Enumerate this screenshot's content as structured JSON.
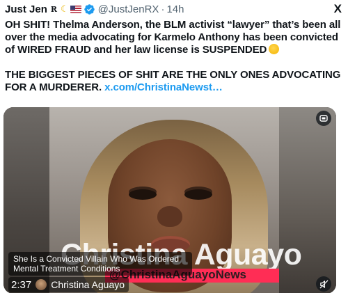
{
  "tweet": {
    "author_name": "Just Jen",
    "author_tag": "R",
    "handle": "@JustJenRX",
    "time_separator": "·",
    "time_ago": "14h",
    "line1": "OH SHIT! Thelma Anderson, the BLM activist “lawyer” that’s been all over the media advocating for Karmelo Anthony has been convicted of WIRED FRAUD and her law license is SUSPENDED",
    "line2": "THE BIGGEST PIECES OF SHIT ARE THE ONLY ONES ADVOCATING FOR A MURDERER.",
    "link_text": "x.com/ChristinaNewst…",
    "close_glyph": "X"
  },
  "video": {
    "overlay_name": "Christina Aguayo",
    "overlay_handle": "@ChristinaAguayoNews",
    "caption": "She Is a Convicted Villain Who Was Ordered Mental Treatment Conditions",
    "duration": "2:37",
    "channel": "Christina Aguayo"
  },
  "icons": {
    "verified": "verified-badge-icon",
    "emoji": "moon-and-us-flag-emoji",
    "grin": "grinning-face-emoji",
    "gif": "gif-icon",
    "mute": "muted-speaker-icon",
    "close": "x-logo-icon"
  },
  "colors": {
    "text": "#0f1419",
    "secondary": "#536471",
    "link": "#1d9bf0",
    "verified": "#1d9bf0",
    "overlay_bar": "#ff2d55"
  }
}
